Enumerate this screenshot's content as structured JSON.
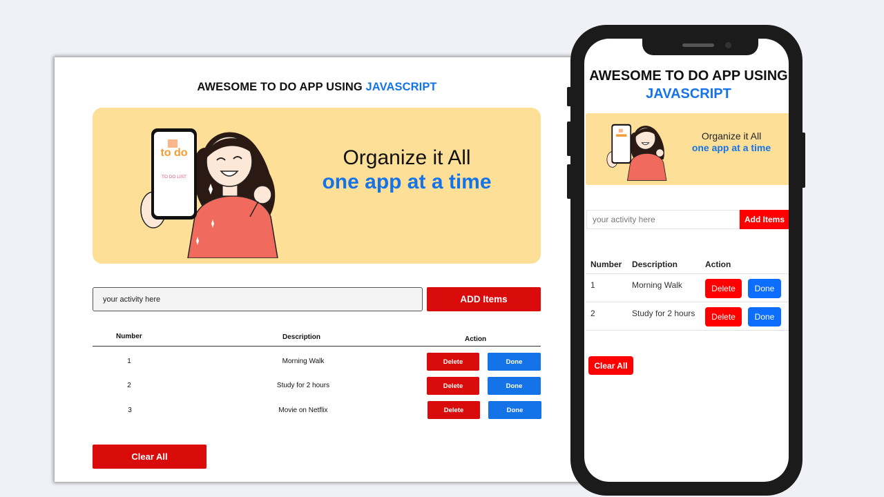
{
  "desktop": {
    "title_prefix": "AWESOME TO DO APP USING",
    "title_highlight": "JAVASCRIPT",
    "banner": {
      "line1": "Organize it All",
      "line2": "one app at a time",
      "phone_logo": "to do",
      "phone_caption": "TO DO LIST"
    },
    "input_placeholder": "your activity here",
    "add_label": "ADD Items",
    "table": {
      "headers": [
        "Number",
        "Description",
        "Action"
      ],
      "rows": [
        {
          "number": "1",
          "description": "Morning Walk",
          "delete": "Delete",
          "done": "Done"
        },
        {
          "number": "2",
          "description": "Study for 2 hours",
          "delete": "Delete",
          "done": "Done"
        },
        {
          "number": "3",
          "description": "Movie on Netflix",
          "delete": "Delete",
          "done": "Done"
        }
      ]
    },
    "clear_label": "Clear All"
  },
  "mobile": {
    "title_prefix": "AWESOME TO DO APP USING",
    "title_highlight": "JAVASCRIPT",
    "banner": {
      "line1": "Organize it All",
      "line2": "one app at a time"
    },
    "input_placeholder": "your activity here",
    "add_label": "Add Items",
    "table": {
      "headers": [
        "Number",
        "Description",
        "Action"
      ],
      "rows": [
        {
          "number": "1",
          "description": "Morning Walk",
          "delete": "Delete",
          "done": "Done"
        },
        {
          "number": "2",
          "description": "Study for 2 hours",
          "delete": "Delete",
          "done": "Done"
        }
      ]
    },
    "clear_label": "Clear All"
  },
  "colors": {
    "accent_blue": "#1473e6",
    "danger_red": "#d90b0b",
    "banner_yellow": "#fddf98"
  }
}
